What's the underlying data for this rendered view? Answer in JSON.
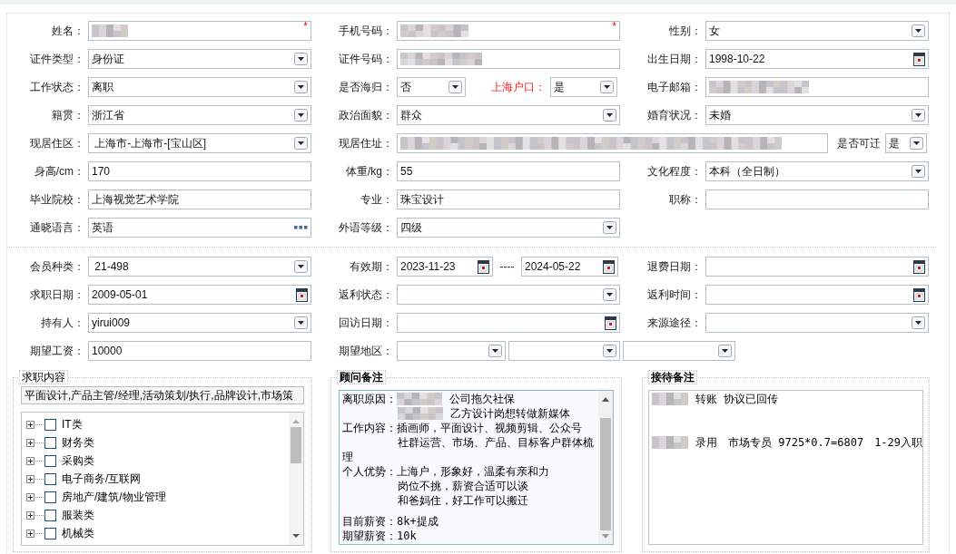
{
  "sections": [
    {
      "rows": [
        [
          {
            "label": "姓名：",
            "parts": [
              {
                "kind": "text",
                "redacted": true,
                "mark": "*"
              }
            ]
          },
          {
            "label": "手机号码：",
            "parts": [
              {
                "kind": "text",
                "redacted": true,
                "mark": "*"
              }
            ]
          },
          {
            "label": "性别：",
            "parts": [
              {
                "kind": "select",
                "value": "女"
              }
            ]
          }
        ],
        [
          {
            "label": "证件类型：",
            "parts": [
              {
                "kind": "select",
                "value": "身份证"
              }
            ]
          },
          {
            "label": "证件号码：",
            "parts": [
              {
                "kind": "text",
                "redacted": true
              }
            ]
          },
          {
            "label": "出生日期：",
            "parts": [
              {
                "kind": "date",
                "value": "1998-10-22"
              }
            ]
          }
        ],
        [
          {
            "label": "工作状态：",
            "parts": [
              {
                "kind": "select",
                "value": "离职"
              }
            ]
          },
          {
            "label": "是否海归：",
            "parts": [
              {
                "kind": "select",
                "value": "否"
              },
              {
                "kind": "label",
                "text": "上海户口：",
                "emphasis": true
              },
              {
                "kind": "select",
                "value": "是"
              }
            ]
          },
          {
            "label": "电子邮箱：",
            "parts": [
              {
                "kind": "text",
                "redacted": true
              }
            ]
          }
        ],
        [
          {
            "label": "籍贯：",
            "parts": [
              {
                "kind": "select",
                "value": "浙江省"
              }
            ]
          },
          {
            "label": "政治面貌：",
            "parts": [
              {
                "kind": "select",
                "value": "群众"
              }
            ]
          },
          {
            "label": "婚育状况：",
            "parts": [
              {
                "kind": "select",
                "value": "未婚"
              }
            ]
          }
        ],
        [
          {
            "label": "现居住区：",
            "parts": [
              {
                "kind": "select",
                "value": " 上海市-上海市-[宝山区]"
              }
            ]
          },
          {
            "label": "现居住址：",
            "parts": [
              {
                "kind": "text",
                "redacted": true
              },
              {
                "kind": "label",
                "text": "是否可迁",
                "emphasis": false
              },
              {
                "kind": "select",
                "value": "是"
              }
            ]
          }
        ],
        [
          {
            "label": "身高/cm：",
            "parts": [
              {
                "kind": "text",
                "value": "170"
              }
            ]
          },
          {
            "label": "体重/kg：",
            "parts": [
              {
                "kind": "text",
                "value": "55"
              }
            ]
          },
          {
            "label": "文化程度：",
            "parts": [
              {
                "kind": "select",
                "value": "本科（全日制）"
              }
            ]
          }
        ],
        [
          {
            "label": "毕业院校：",
            "parts": [
              {
                "kind": "text",
                "value": "上海视觉艺术学院"
              }
            ]
          },
          {
            "label": "专业：",
            "parts": [
              {
                "kind": "text",
                "value": "珠宝设计"
              }
            ]
          },
          {
            "label": "职称：",
            "parts": [
              {
                "kind": "text"
              }
            ]
          }
        ],
        [
          {
            "label": "通晓语言：",
            "parts": [
              {
                "kind": "lookup",
                "value": "英语"
              }
            ]
          },
          {
            "label": "外语等级：",
            "parts": [
              {
                "kind": "select",
                "value": "四级"
              }
            ]
          }
        ]
      ]
    },
    {
      "rows": [
        [
          {
            "label": "会员种类：",
            "parts": [
              {
                "kind": "select",
                "value": " 21-498"
              }
            ]
          },
          {
            "label": "有效期：",
            "parts": [
              {
                "kind": "date",
                "value": "2023-11-23"
              },
              {
                "kind": "separator",
                "text": "----"
              },
              {
                "kind": "date",
                "value": "2024-05-22"
              }
            ]
          },
          {
            "label": "退费日期：",
            "parts": [
              {
                "kind": "date"
              }
            ]
          }
        ],
        [
          {
            "label": "求职日期：",
            "parts": [
              {
                "kind": "date",
                "value": "2009-05-01"
              }
            ]
          },
          {
            "label": "返利状态：",
            "parts": [
              {
                "kind": "select"
              }
            ]
          },
          {
            "label": "返利时间：",
            "parts": [
              {
                "kind": "date"
              }
            ]
          }
        ],
        [
          {
            "label": "持有人：",
            "parts": [
              {
                "kind": "select",
                "value": "yirui009"
              }
            ]
          },
          {
            "label": "回访日期：",
            "parts": [
              {
                "kind": "date"
              }
            ]
          },
          {
            "label": "来源途径：",
            "parts": [
              {
                "kind": "select"
              }
            ]
          }
        ],
        [
          {
            "label": "期望工资：",
            "parts": [
              {
                "kind": "text",
                "value": "10000"
              }
            ]
          },
          {
            "label": "期望地区：",
            "parts": [
              {
                "kind": "select"
              },
              {
                "kind": "select"
              },
              {
                "kind": "select"
              }
            ]
          }
        ]
      ]
    }
  ],
  "job_intent": {
    "title": "求职内容",
    "value": "平面设计,产品主管/经理,活动策划/执行,品牌设计,市场策",
    "tree": [
      {
        "label": "IT类",
        "checked": false,
        "expanded": false
      },
      {
        "label": "财务类",
        "checked": false,
        "expanded": false
      },
      {
        "label": "采购类",
        "checked": false,
        "expanded": false
      },
      {
        "label": "电子商务/互联网",
        "checked": false,
        "expanded": false
      },
      {
        "label": "房地产/建筑/物业管理",
        "checked": false,
        "expanded": false
      },
      {
        "label": "服装类",
        "checked": false,
        "expanded": false
      },
      {
        "label": "机械类",
        "checked": false,
        "expanded": false
      }
    ]
  },
  "consultant_notes": {
    "title": "顾问备注",
    "lines": [
      {
        "kind": "labeled",
        "lead": "离职原因：",
        "redacted": true,
        "text": "公司拖欠社保"
      },
      {
        "kind": "continued",
        "redacted": true,
        "text": "乙方设计岗想转做新媒体"
      },
      {
        "kind": "labeled",
        "lead": "工作内容：",
        "text": "插画师，平面设计、视频剪辑、公众号"
      },
      {
        "kind": "continued",
        "text": "社群运营、市场、产品、目标客户群体梳"
      },
      {
        "kind": "wrapped",
        "text": "理"
      },
      {
        "kind": "labeled",
        "lead": "个人优势：",
        "text": "上海户，形象好，温柔有亲和力"
      },
      {
        "kind": "continued",
        "text": "岗位不挑，薪资合适可以谈"
      },
      {
        "kind": "continued",
        "text": "和爸妈住，好工作可以搬迁"
      },
      {
        "kind": "blank"
      },
      {
        "kind": "labeled",
        "lead": "目前薪资：",
        "text": "8k+提成"
      },
      {
        "kind": "labeled",
        "lead": "期望薪资：",
        "text": "10k"
      }
    ]
  },
  "reception_notes": {
    "title": "接待备注",
    "lines": [
      {
        "kind": "wrapped",
        "redacted": true,
        "text": "转账 协议已回传"
      },
      {
        "kind": "blank"
      },
      {
        "kind": "blank"
      },
      {
        "kind": "wrapped",
        "redacted": true,
        "text": "录用　市场专员 9725*0.7=6807　1-29入职"
      }
    ]
  }
}
